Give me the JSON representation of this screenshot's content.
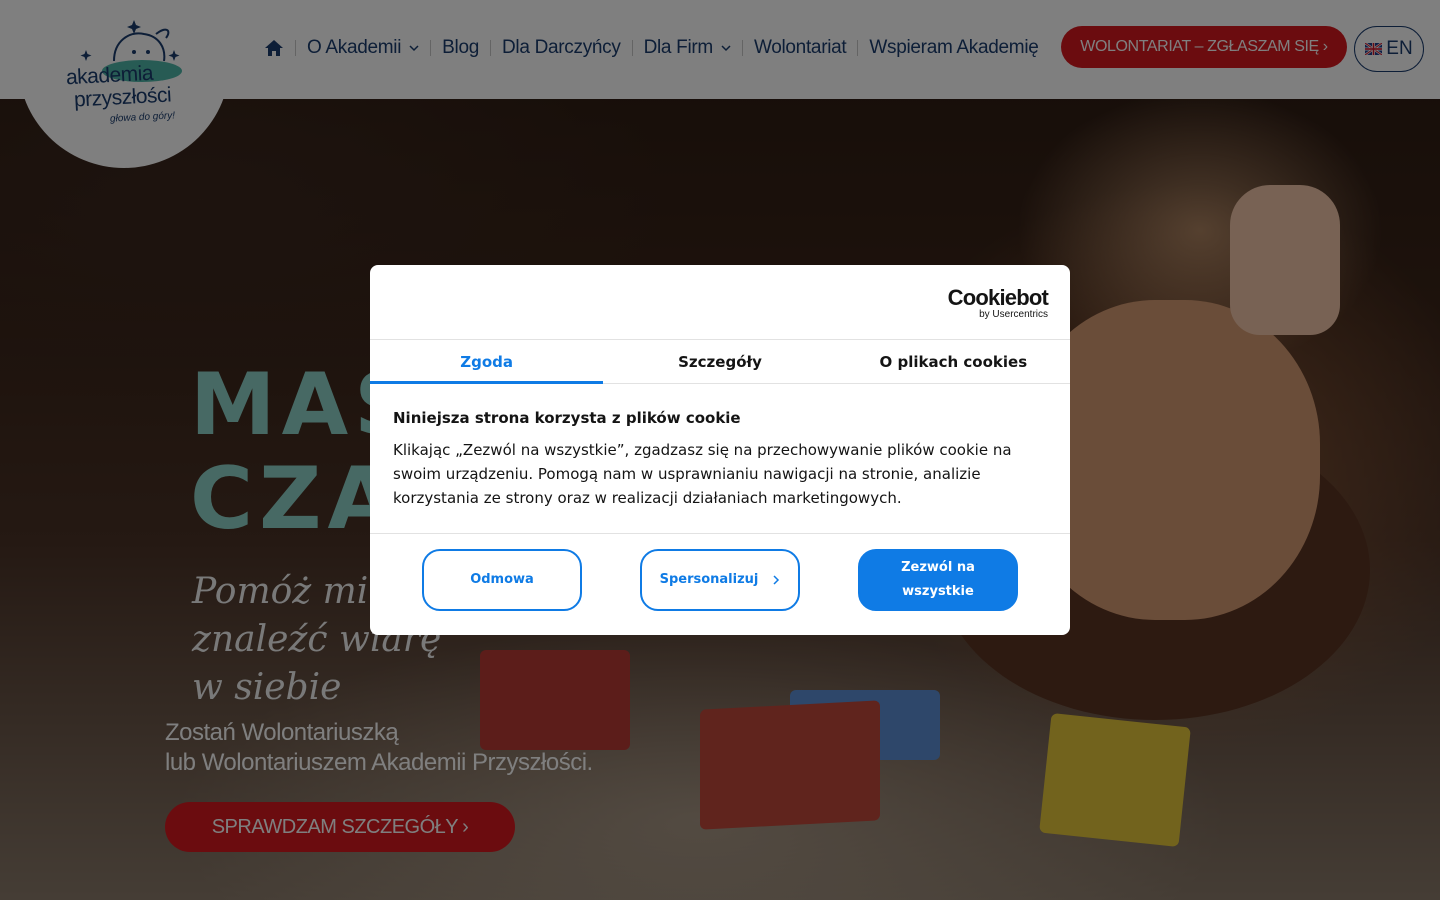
{
  "header": {
    "logo": {
      "line1": "akademia",
      "line2": "przyszłości",
      "tagline": "głowa do góry!"
    },
    "nav": [
      {
        "label": "O Akademii",
        "has_dropdown": true
      },
      {
        "label": "Blog",
        "has_dropdown": false
      },
      {
        "label": "Dla Darczyńcy",
        "has_dropdown": false
      },
      {
        "label": "Dla Firm",
        "has_dropdown": true
      },
      {
        "label": "Wolontariat",
        "has_dropdown": false
      },
      {
        "label": "Wspieram Akademię",
        "has_dropdown": false
      }
    ],
    "cta_label": "WOLONTARIAT – ZGŁASZAM SIĘ",
    "lang_label": "EN",
    "icons": {
      "home": "home-icon",
      "chevron": "chevron-down-icon",
      "flag": "uk-flag-icon"
    }
  },
  "hero": {
    "title_line1": "MAS",
    "title_line2": "CZA",
    "script_line1": "Pomóż mi",
    "script_line2": "znaleźć wiarę",
    "script_line3": "w siebie",
    "subtitle_line1": "Zostań Wolontariuszką",
    "subtitle_line2": "lub Wolontariuszem Akademii Przyszłości.",
    "cta_label": "SPRAWDZAM SZCZEGÓŁY"
  },
  "cookie_dialog": {
    "brand": "Cookiebot",
    "brand_by": "by Usercentrics",
    "tabs": [
      {
        "label": "Zgoda",
        "active": true
      },
      {
        "label": "Szczegóły",
        "active": false
      },
      {
        "label": "O plikach cookies",
        "active": false
      }
    ],
    "heading": "Niniejsza strona korzysta z plików cookie",
    "body": "Klikając „Zezwól na wszystkie”, zgadzasz się na przechowywanie plików cookie na swoim urządzeniu. Pomogą nam w usprawnianiu nawigacji na stronie, analizie korzystania ze strony oraz w realizacji działaniach marketingowych.",
    "buttons": {
      "deny": "Odmowa",
      "customize": "Spersonalizuj",
      "allow_all": "Zezwól na wszystkie"
    }
  },
  "colors": {
    "brand_navy": "#1a3c6e",
    "brand_red": "#d7191f",
    "cookiebot_blue": "#0f7be5",
    "hero_title_teal": "#8fd3c8"
  }
}
